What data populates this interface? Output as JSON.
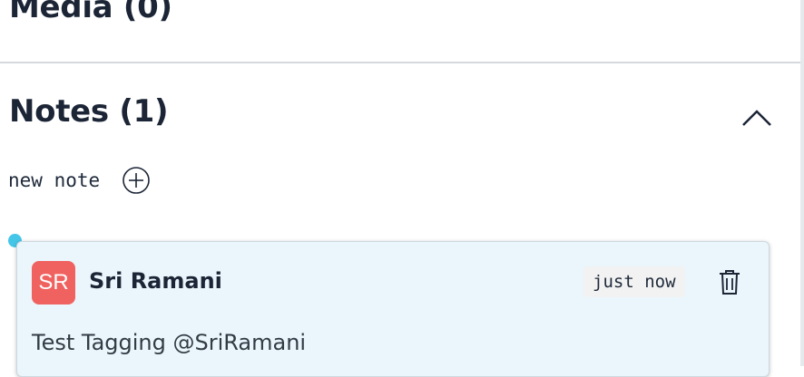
{
  "media": {
    "title": "Media (0)"
  },
  "notes": {
    "title": "Notes (1)",
    "new_note_label": "new note",
    "items": [
      {
        "initials": "SR",
        "author": "Sri Ramani",
        "timestamp": "just now",
        "text": "Test Tagging @SriRamani"
      }
    ]
  },
  "colors": {
    "avatar_bg": "#f0625f",
    "unread_dot": "#45c6e8",
    "card_bg": "#eaf6fb",
    "heading_text": "#1c2536"
  },
  "icons": {
    "collapse": "chevron-up-icon",
    "add": "plus-circle-icon",
    "delete": "trash-icon"
  }
}
